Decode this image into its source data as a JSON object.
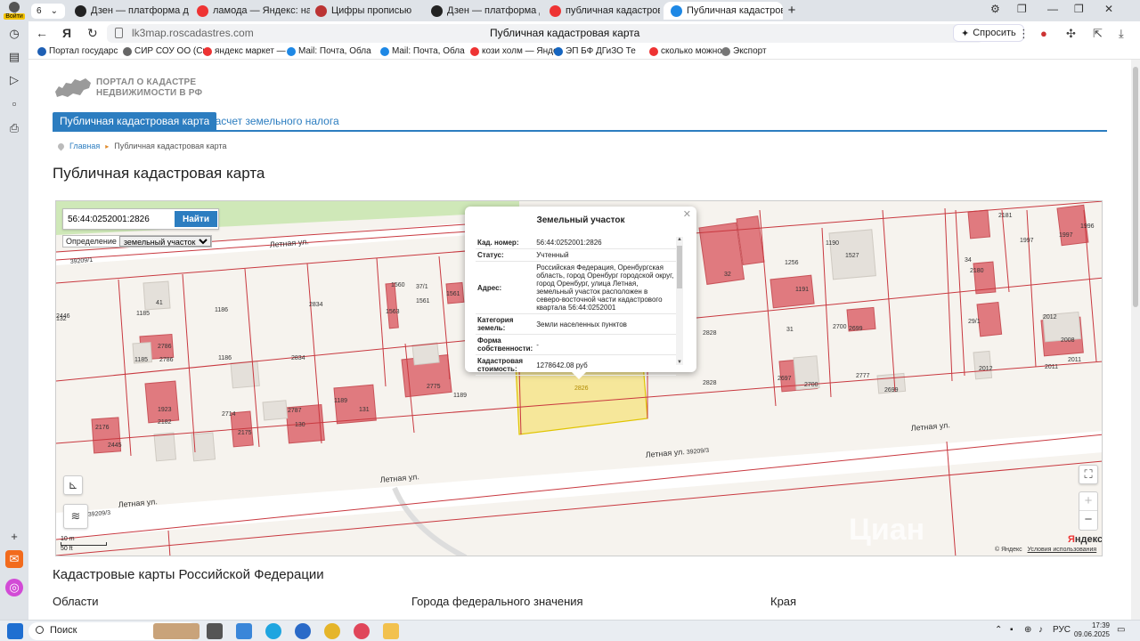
{
  "browser": {
    "tab_count": "6",
    "tabs": [
      {
        "label": "Дзен — платформа для п",
        "color": "#222"
      },
      {
        "label": "ламода — Яндекс: нашёл",
        "color": "#e33"
      },
      {
        "label": "Цифры прописью",
        "color": "#b33"
      },
      {
        "label": "Дзен — платформа для п",
        "color": "#222"
      },
      {
        "label": "публичная кадастровая к",
        "color": "#e33"
      },
      {
        "label": "Публичная кадастровая",
        "color": "#1e88e5"
      }
    ],
    "profile_label": "Войти",
    "url": "lk3map.roscadastres.com",
    "page_title": "Публичная кадастровая карта",
    "ask_button": "Спросить",
    "bookmarks": [
      {
        "label": "Портал государс",
        "color": "#1e5fb4"
      },
      {
        "label": "СИР СОУ ОО (Си",
        "color": "#666"
      },
      {
        "label": "яндекс маркет —",
        "color": "#e33"
      },
      {
        "label": "Mail: Почта, Обла",
        "color": "#1e88e5"
      },
      {
        "label": "Mail: Почта, Обла",
        "color": "#1e88e5"
      },
      {
        "label": "кози холм — Янде",
        "color": "#e33"
      },
      {
        "label": "ЭП БФ ДГиЗО Те",
        "color": "#1565c0"
      },
      {
        "label": "сколько можно с",
        "color": "#e33"
      },
      {
        "label": "Экспорт",
        "color": "#777"
      }
    ]
  },
  "site": {
    "logo_line1": "ПОРТАЛ О КАДАСТРЕ",
    "logo_line2": "НЕДВИЖИМОСТИ В РФ",
    "menu_active": "Публичная кадастровая карта",
    "menu_other": "Расчет земельного налога",
    "breadcrumb_home": "Главная",
    "breadcrumb_current": "Публичная кадастровая карта",
    "heading": "Публичная кадастровая карта",
    "section_heading": "Кадастровые карты Российской Федерации",
    "columns": [
      "Области",
      "Города федерального значения",
      "Края"
    ]
  },
  "map": {
    "search_value": "56:44:0252001:2826",
    "search_button": "Найти",
    "definition_label": "Определение",
    "definition_value": "земельный участок",
    "scale_m": "10 m",
    "scale_ft": "50 ft",
    "copyright": "© Яндекс",
    "terms": "Условия использования",
    "yandex_logo_a": "Я",
    "yandex_logo_b": "ндекс",
    "watermark": "Циан",
    "street_labels": [
      "Летная ул.",
      "Летная ул.",
      "Летная ул.",
      "Летная ул.",
      "Летная ул."
    ],
    "quarter_labels": [
      "39209/1",
      "39209/3",
      "39209/3"
    ],
    "parcel_labels": [
      "2826",
      "2828",
      "2828",
      "2834",
      "2834",
      "1186",
      "1186",
      "1185",
      "1185",
      "2786",
      "2786",
      "41",
      "37/1",
      "1561",
      "1561",
      "1560",
      "1563",
      "2775",
      "1189",
      "1189",
      "131",
      "2787",
      "130",
      "2714",
      "2175",
      "1923",
      "2182",
      "2176",
      "2445",
      "2446",
      "132",
      "32",
      "1256",
      "1191",
      "1527",
      "1190",
      "31",
      "2700",
      "2699",
      "2697",
      "2700",
      "2777",
      "2699",
      "34",
      "2180",
      "2181",
      "1997",
      "1997",
      "1996",
      "29/1",
      "2012",
      "2012",
      "2011",
      "2011",
      "2008",
      "2006",
      "1298"
    ],
    "popup": {
      "title": "Земельный участок",
      "rows": [
        {
          "k": "Кад. номер:",
          "v": "56:44:0252001:2826"
        },
        {
          "k": "Статус:",
          "v": "Учтенный"
        },
        {
          "k": "Адрес:",
          "v": "Российская Федерация, Оренбургская область, город Оренбург городской округ, город Оренбург, улица Летная, земельный участок расположен в северо-восточной части кадастрового квартала 56:44:0252001"
        },
        {
          "k": "Категория земель:",
          "v": "Земли населенных пунктов"
        },
        {
          "k": "Форма собственности:",
          "v": "-"
        },
        {
          "k": "Кадастровая стоимость:",
          "v": "1278642.08 руб"
        }
      ]
    }
  },
  "taskbar": {
    "search": "Поиск",
    "lang": "РУС",
    "time": "17:39",
    "date": "09.06.2025"
  },
  "colors": {
    "accent": "#2c7dc0",
    "building": "#e07a7f",
    "selected_parcel": "#f6e79a"
  }
}
